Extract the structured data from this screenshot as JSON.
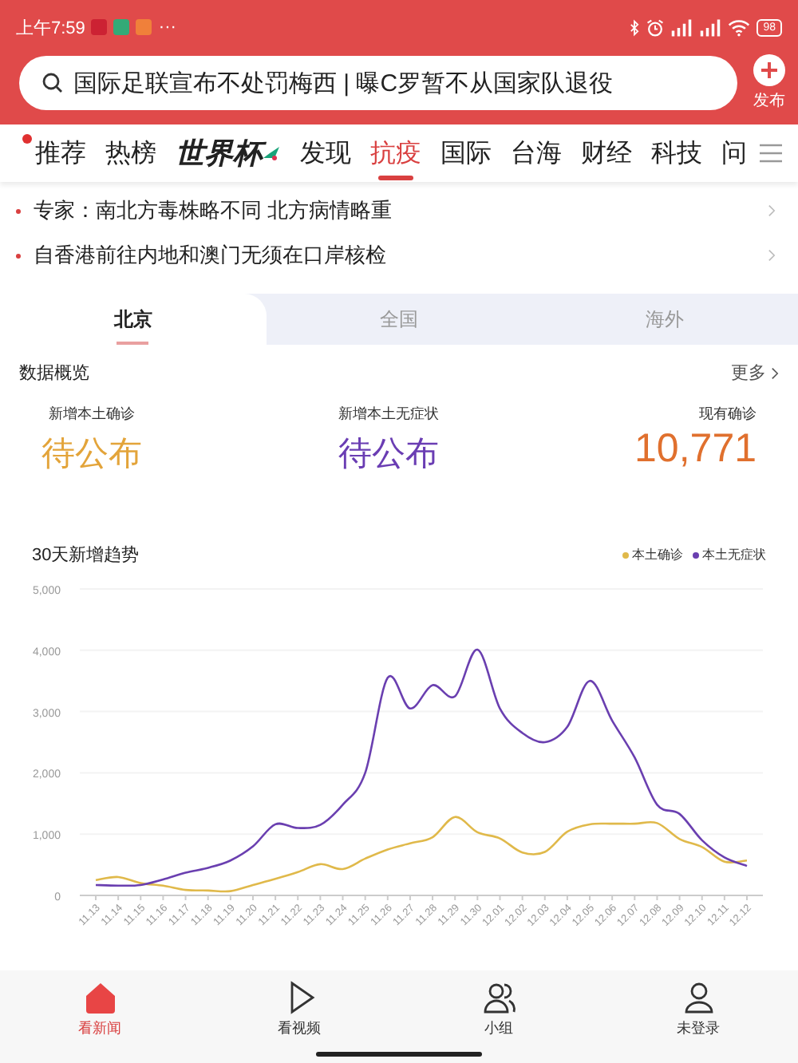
{
  "status_bar": {
    "time": "上午7:59",
    "more": "···",
    "battery": "98"
  },
  "search": {
    "value": "国际足联宣布不处罚梅西 | 曝C罗暂不从国家队退役",
    "publish_label": "发布"
  },
  "channel_tabs": [
    {
      "label": "推荐",
      "kind": "text",
      "dot": true,
      "selected": false
    },
    {
      "label": "热榜",
      "kind": "text",
      "dot": false,
      "selected": false
    },
    {
      "label": "世界杯",
      "kind": "logo",
      "dot": false,
      "selected": false
    },
    {
      "label": "发现",
      "kind": "text",
      "dot": false,
      "selected": false
    },
    {
      "label": "抗疫",
      "kind": "text",
      "dot": false,
      "selected": true
    },
    {
      "label": "国际",
      "kind": "text",
      "dot": false,
      "selected": false
    },
    {
      "label": "台海",
      "kind": "text",
      "dot": false,
      "selected": false
    },
    {
      "label": "财经",
      "kind": "text",
      "dot": false,
      "selected": false
    },
    {
      "label": "科技",
      "kind": "text",
      "dot": false,
      "selected": false
    },
    {
      "label": "问",
      "kind": "text",
      "dot": false,
      "selected": false
    }
  ],
  "news": [
    {
      "title": "专家：南北方毒株略不同 北方病情略重"
    },
    {
      "title": "自香港前往内地和澳门无须在口岸核检"
    }
  ],
  "region_tabs": [
    {
      "label": "北京",
      "selected": true
    },
    {
      "label": "全国",
      "selected": false
    },
    {
      "label": "海外",
      "selected": false
    }
  ],
  "overview": {
    "title": "数据概览",
    "more": "更多",
    "stats": [
      {
        "label": "新增本土确诊",
        "value": "待公布",
        "color": "#e3a43a"
      },
      {
        "label": "新增本土无症状",
        "value": "待公布",
        "color": "#6a3db3"
      },
      {
        "label": "现有确诊",
        "value": "10,771",
        "color": "#e0702e"
      }
    ]
  },
  "trend": {
    "title": "30天新增趋势",
    "chart_data": {
      "type": "line",
      "categories": [
        "11.13",
        "11.14",
        "11.15",
        "11.16",
        "11.17",
        "11.18",
        "11.19",
        "11.20",
        "11.21",
        "11.22",
        "11.23",
        "11.24",
        "11.25",
        "11.26",
        "11.27",
        "11.28",
        "11.29",
        "11.30",
        "12.01",
        "12.02",
        "12.03",
        "12.04",
        "12.05",
        "12.06",
        "12.07",
        "12.08",
        "12.09",
        "12.10",
        "12.11",
        "12.12"
      ],
      "series": [
        {
          "name": "本土确诊",
          "color": "#e0b94a",
          "values": [
            250,
            300,
            200,
            160,
            90,
            80,
            70,
            170,
            270,
            380,
            510,
            430,
            600,
            750,
            850,
            950,
            1280,
            1030,
            930,
            700,
            710,
            1040,
            1160,
            1170,
            1170,
            1180,
            920,
            790,
            550,
            570
          ]
        },
        {
          "name": "本土无症状",
          "color": "#6a3fb0",
          "values": [
            170,
            160,
            170,
            260,
            370,
            450,
            570,
            800,
            1160,
            1100,
            1150,
            1480,
            2000,
            3550,
            3050,
            3430,
            3250,
            4010,
            3050,
            2650,
            2500,
            2750,
            3500,
            2850,
            2250,
            1480,
            1330,
            900,
            620,
            480
          ]
        }
      ],
      "ylim": [
        0,
        5000
      ],
      "grid": true,
      "yticks": [
        {
          "value": 0,
          "label": "0"
        },
        {
          "value": 1000,
          "label": "1,000"
        },
        {
          "value": 2000,
          "label": "2,000"
        },
        {
          "value": 3000,
          "label": "3,000"
        },
        {
          "value": 4000,
          "label": "4,000"
        },
        {
          "value": 5000,
          "label": "5,000"
        }
      ]
    }
  },
  "bottom_nav": [
    {
      "label": "看新闻",
      "kind": "home",
      "selected": true
    },
    {
      "label": "看视频",
      "kind": "video",
      "selected": false
    },
    {
      "label": "小组",
      "kind": "group",
      "selected": false
    },
    {
      "label": "未登录",
      "kind": "user",
      "selected": false
    }
  ]
}
